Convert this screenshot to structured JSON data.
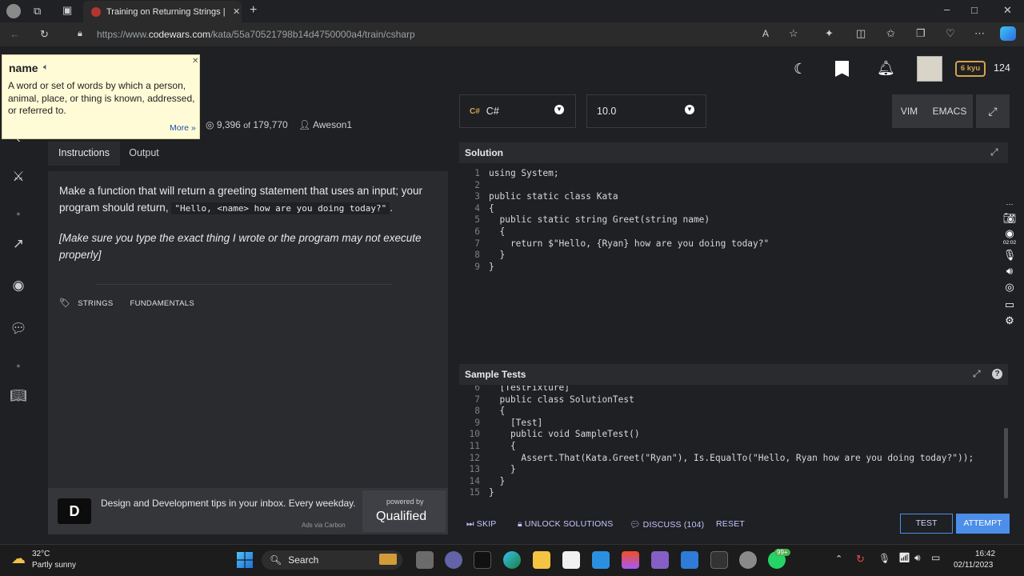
{
  "browser": {
    "tab_title": "Training on Returning Strings | C",
    "url_prefix": "https://www.",
    "url_domain": "codewars.com",
    "url_path": "/kata/55a70521798b14d4750000a4/train/csharp"
  },
  "tooltip": {
    "word": "name",
    "definition": "A word or set of words by which a person, animal, place, or thing is known, addressed, or referred to.",
    "more": "More »"
  },
  "kata": {
    "stats_completed": "9,396",
    "stats_of": "of",
    "stats_total": "179,770",
    "author": "Aweson1"
  },
  "header": {
    "rank": "6 kyu",
    "honor": "124"
  },
  "tabs": {
    "instructions": "Instructions",
    "output": "Output"
  },
  "instructions": {
    "line1_a": "Make a function that will return a greeting statement that uses an input; your program should return,",
    "line1_code": "\"Hello, <name> how are you doing today?\"",
    "line1_end": ".",
    "line2": "[Make sure you type the exact thing I wrote or the program may not execute properly]"
  },
  "tags": [
    "STRINGS",
    "FUNDAMENTALS"
  ],
  "ad": {
    "text": "Design and Development tips in your inbox. Every weekday.",
    "via": "Ads via Carbon",
    "powered_by": "powered by",
    "brand": "Qualified"
  },
  "editor_toolbar": {
    "language": "C#",
    "version": "10.0",
    "vim": "VIM",
    "emacs": "EMACS"
  },
  "solution": {
    "title": "Solution",
    "lines": [
      {
        "n": "1",
        "t": "using System;"
      },
      {
        "n": "2",
        "t": ""
      },
      {
        "n": "3",
        "t": "public static class Kata"
      },
      {
        "n": "4",
        "t": "{"
      },
      {
        "n": "5",
        "t": "  public static string Greet(string name)"
      },
      {
        "n": "6",
        "t": "  {"
      },
      {
        "n": "7",
        "t": "    return $\"Hello, {Ryan} how are you doing today?\""
      },
      {
        "n": "8",
        "t": "  }"
      },
      {
        "n": "9",
        "t": "}"
      }
    ]
  },
  "tests": {
    "title": "Sample Tests",
    "lines": [
      {
        "n": "6",
        "t": "  [TestFixture]"
      },
      {
        "n": "7",
        "t": "  public class SolutionTest"
      },
      {
        "n": "8",
        "t": "  {"
      },
      {
        "n": "9",
        "t": "    [Test]"
      },
      {
        "n": "10",
        "t": "    public void SampleTest()"
      },
      {
        "n": "11",
        "t": "    {"
      },
      {
        "n": "12",
        "t": "      Assert.That(Kata.Greet(\"Ryan\"), Is.EqualTo(\"Hello, Ryan how are you doing today?\"));"
      },
      {
        "n": "13",
        "t": "    }"
      },
      {
        "n": "14",
        "t": "  }"
      },
      {
        "n": "15",
        "t": "}"
      }
    ]
  },
  "actions": {
    "skip": "SKIP",
    "unlock": "UNLOCK SOLUTIONS",
    "discuss": "DISCUSS (104)",
    "reset": "RESET",
    "test": "TEST",
    "attempt": "ATTEMPT"
  },
  "recorder": {
    "time": "02:02"
  },
  "taskbar": {
    "temp": "32°C",
    "weather": "Partly sunny",
    "search": "Search",
    "badge": "99+",
    "time": "16:42",
    "date": "02/11/2023"
  },
  "colors": {
    "accent": "#4c8ee8",
    "rank": "#d4a24c",
    "link": "#c6c6ff"
  }
}
